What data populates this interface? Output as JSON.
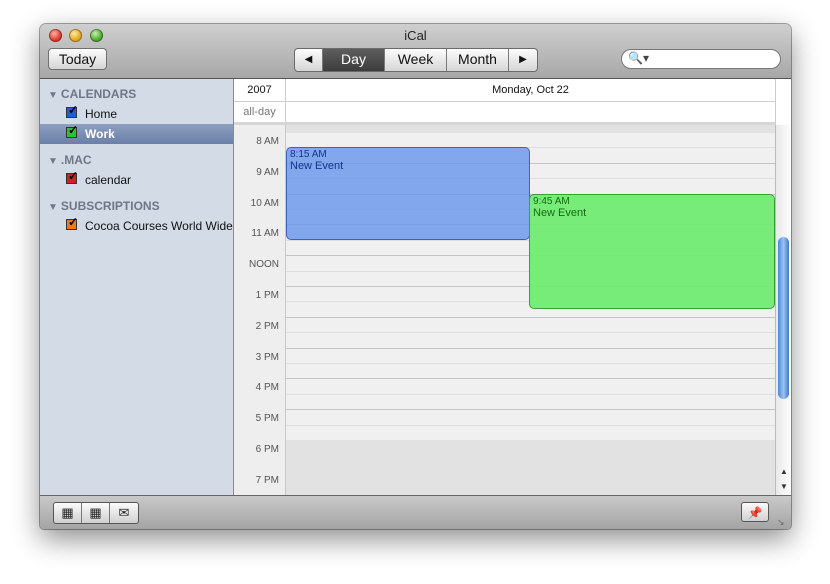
{
  "window": {
    "title": "iCal"
  },
  "toolbar": {
    "today_label": "Today",
    "nav_prev": "◀",
    "nav_next": "▶",
    "views": {
      "day": "Day",
      "week": "Week",
      "month": "Month",
      "selected": "Day"
    },
    "search": {
      "icon": "search-icon",
      "placeholder": ""
    }
  },
  "sidebar": {
    "sections": [
      {
        "title": "CALENDARS",
        "items": [
          {
            "label": "Home",
            "checked": true,
            "color": "#1f5fd0"
          },
          {
            "label": "Work",
            "checked": true,
            "color": "#2fbf2f",
            "selected": true
          }
        ]
      },
      {
        "title": ".MAC",
        "items": [
          {
            "label": "calendar",
            "checked": true,
            "color": "#d02020"
          }
        ]
      },
      {
        "title": "SUBSCRIPTIONS",
        "items": [
          {
            "label": "Cocoa Courses World Wide",
            "checked": true,
            "color": "#f07a10"
          }
        ]
      }
    ]
  },
  "day_view": {
    "year": "2007",
    "date": "Monday, Oct 22",
    "allday_label": "all-day",
    "hours": [
      "8 AM",
      "9 AM",
      "10 AM",
      "11 AM",
      "NOON",
      "1 PM",
      "2 PM",
      "3 PM",
      "4 PM",
      "5 PM",
      "6 PM",
      "7 PM"
    ],
    "events": [
      {
        "time": "8:15 AM",
        "title": "New Event",
        "color": "#6a96ec"
      },
      {
        "time": "9:45 AM",
        "title": "New Event",
        "color": "#6eec6e"
      }
    ]
  },
  "bottombar": {
    "buttons": [
      {
        "icon": "calendar-list-icon"
      },
      {
        "icon": "mini-month-icon"
      },
      {
        "icon": "mail-icon"
      }
    ],
    "pin_icon": "pin-icon"
  }
}
